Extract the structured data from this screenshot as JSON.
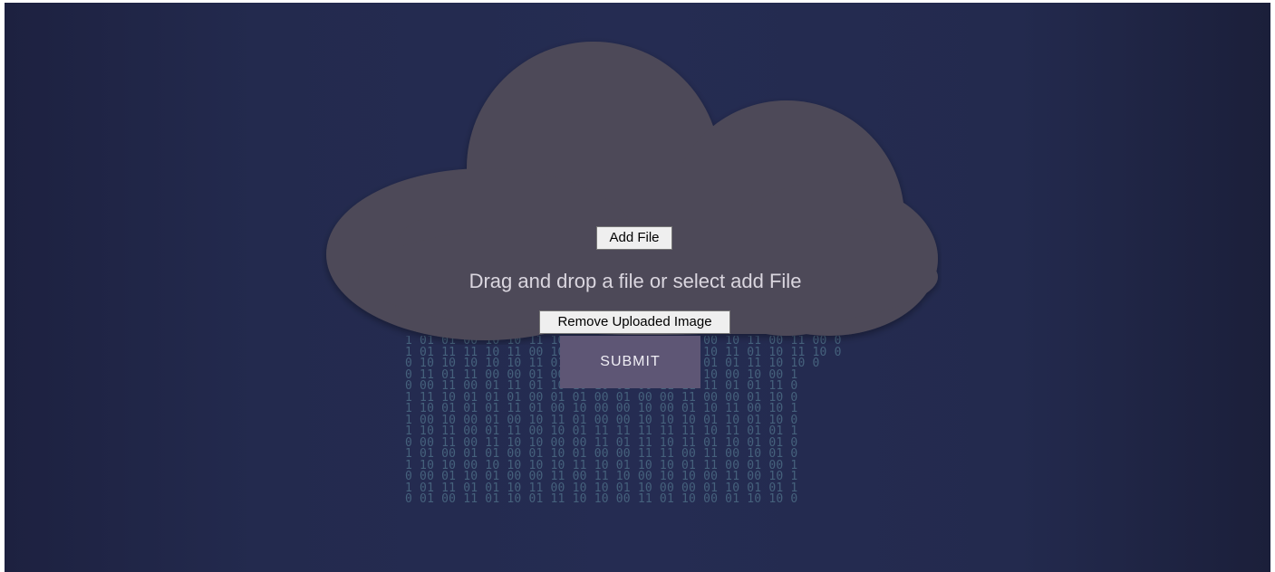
{
  "upload": {
    "add_file_label": "Add File",
    "hint": "Drag and drop a file or select add File",
    "remove_label": "Remove Uploaded Image"
  },
  "submit_label": "SUBMIT",
  "binary_rain": [
    "1 01 01 00 10 10 11 10 11 00 01 11 01 01 00 10 11 00 11 00 0",
    "1 01 11 11 10 11 00 10 01 01 10 11 00 01 10 11 01 10 11 10 0",
    "0 10 10 10 10 10 11 01 10 01 00 11 10 00 01 01 11 10 10 0",
    "0 11 01 11 00 00 01 00 11 11 00 11 11 01 10 00 10 00 1",
    "0 00 11 00 01 11 01 10 10 10 01 00 11 11 11 01 01 11 0",
    "1 11 10 01 01 01 00 01 01 00 01 00 00 11 00 00 01 10 0",
    "1 10 01 01 01 11 01 00 10 00 00 10 00 01 10 11 00 10 1",
    "1 00 10 00 01 00 10 11 01 00 00 10 10 10 01 10 01 10 0",
    "1 10 11 00 01 11 00 10 01 11 11 11 11 11 10 11 01 01 1",
    "0 00 11 00 11 10 10 00 00 11 01 11 10 11 01 10 01 01 0",
    "1 01 00 01 01 00 01 10 01 00 00 11 11 00 11 00 10 01 0",
    "1 10 10 00 10 10 10 10 11 10 01 10 10 01 11 00 01 00 1",
    "0 00 01 10 01 00 00 11 00 11 10 00 10 10 00 11 00 10 1",
    "1 01 11 01 01 10 11 00 10 10 01 10 00 00 01 10 01 01 1",
    "0 01 00 11 01 10 01 11 10 10 00 11 01 10 00 01 10 10 0"
  ],
  "colors": {
    "background": "#232a4e",
    "cloud": "#4e4a58",
    "submit": "#5e5675",
    "hint_text": "#dad6df",
    "rain": "#4b6b84"
  },
  "icons": {
    "cloud": "cloud-shape"
  }
}
